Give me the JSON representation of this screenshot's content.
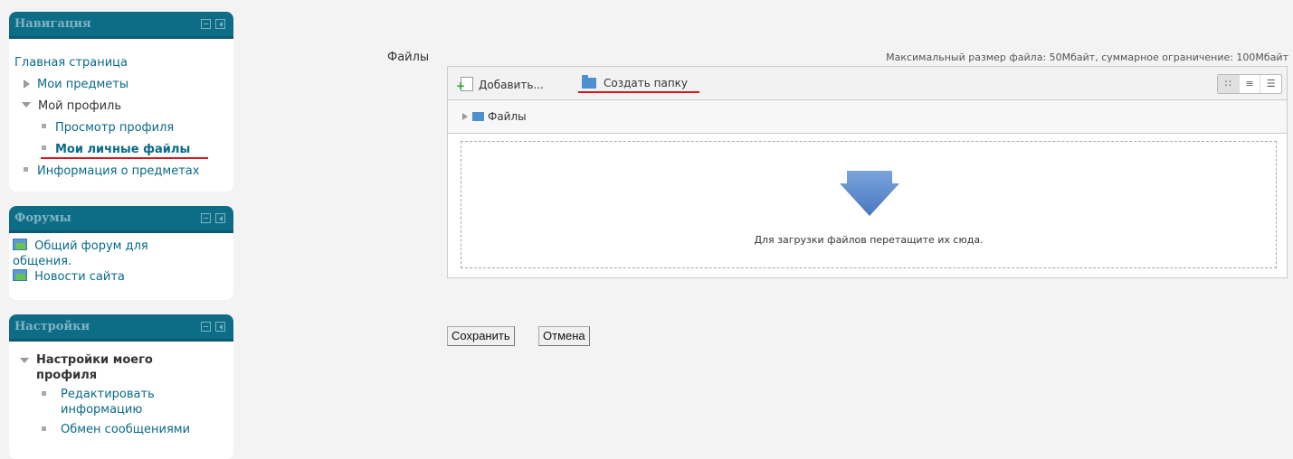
{
  "blocks": {
    "navigation": {
      "title": "Навигация",
      "items": [
        {
          "label": "Главная страница"
        },
        {
          "label": "Мои предметы"
        },
        {
          "label": "Мой профиль"
        },
        {
          "label": "Просмотр профиля"
        },
        {
          "label": "Мои личные файлы"
        },
        {
          "label": "Информация о предметах"
        }
      ]
    },
    "forums": {
      "title": "Форумы",
      "items": [
        {
          "label": "Общий форум для общения."
        },
        {
          "label": "Новости сайта"
        }
      ]
    },
    "settings": {
      "title": "Настройки",
      "items": [
        {
          "label": "Настройки моего профиля"
        },
        {
          "label": "Редактировать информацию"
        },
        {
          "label": "Обмен сообщениями"
        }
      ]
    }
  },
  "main": {
    "files_label": "Файлы",
    "max_size": "Максимальный размер файла: 50Мбайт, суммарное ограничение: 100Мбайт",
    "toolbar": {
      "add_label": "Добавить...",
      "mkdir_label": "Создать папку"
    },
    "path_label": "Файлы",
    "drop_text": "Для загрузки файлов перетащите их сюда.",
    "save_label": "Сохранить",
    "cancel_label": "Отмена"
  },
  "colors": {
    "block_header": "#0e6d86",
    "link": "#0a6a8a",
    "highlight_underline": "#d8141c",
    "drop_arrow": "#5b86c8"
  },
  "icons": [
    "hide-block-icon",
    "dock-block-icon",
    "forum-icon",
    "add-file-icon",
    "folder-icon",
    "view-icons-icon",
    "view-list-icon",
    "view-tree-icon",
    "drop-arrow-icon"
  ]
}
